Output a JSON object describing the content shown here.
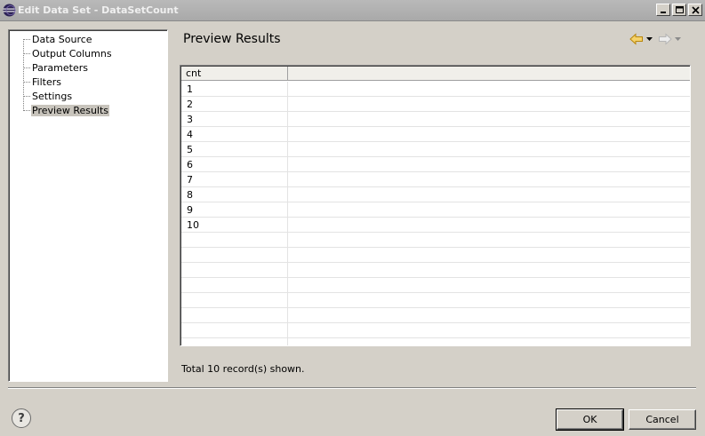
{
  "window": {
    "title": "Edit Data Set - DataSetCount",
    "icon": "eclipse-icon"
  },
  "tree": {
    "items": [
      {
        "label": "Data Source",
        "selected": false
      },
      {
        "label": "Output Columns",
        "selected": false
      },
      {
        "label": "Parameters",
        "selected": false
      },
      {
        "label": "Filters",
        "selected": false
      },
      {
        "label": "Settings",
        "selected": false
      },
      {
        "label": "Preview Results",
        "selected": true
      }
    ]
  },
  "page": {
    "title": "Preview Results",
    "back_icon": "back-arrow-icon",
    "forward_icon": "forward-arrow-icon"
  },
  "grid": {
    "columns": [
      "cnt",
      ""
    ],
    "rows": [
      "1",
      "2",
      "3",
      "4",
      "5",
      "6",
      "7",
      "8",
      "9",
      "10"
    ],
    "empty_rows": 8
  },
  "status": {
    "text": "Total 10 record(s) shown."
  },
  "buttons": {
    "help_icon": "help-icon",
    "ok_label": "OK",
    "cancel_label": "Cancel"
  },
  "colors": {
    "titlebar": "#aaaaaa",
    "dialog_bg": "#d4d0c8",
    "selection": "#c8c4bc"
  }
}
